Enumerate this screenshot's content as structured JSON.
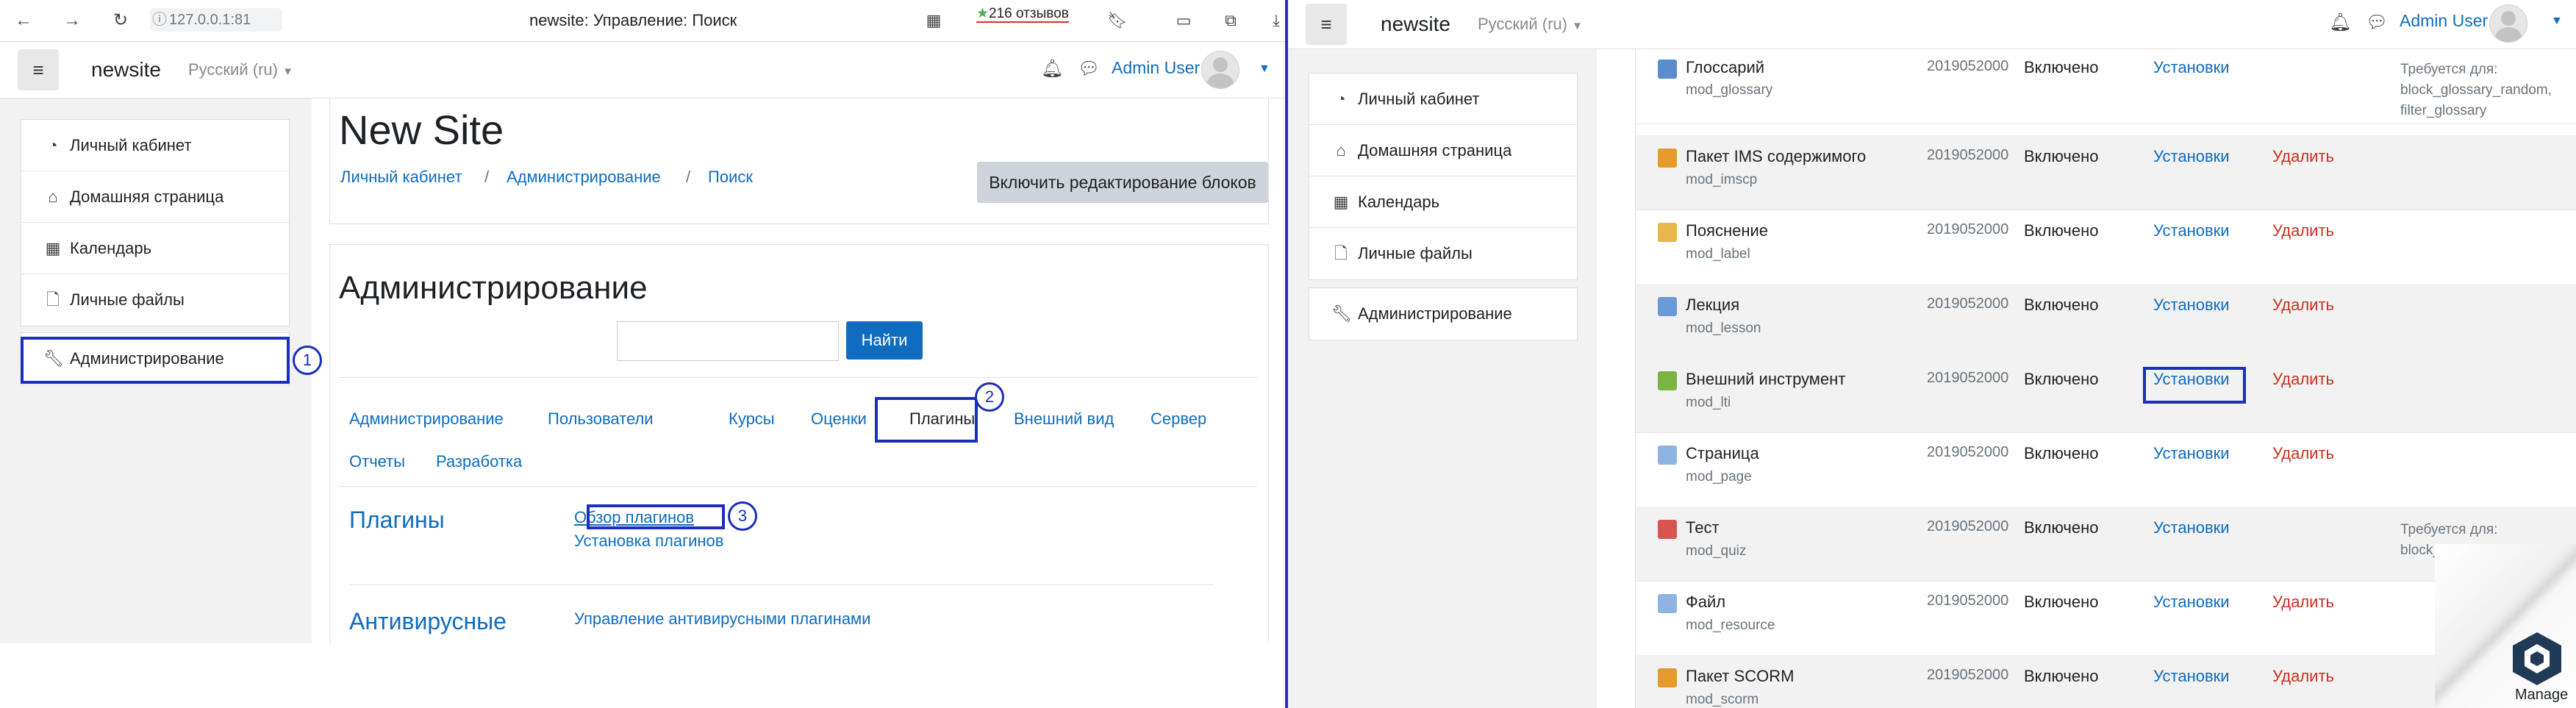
{
  "left": {
    "browser": {
      "url": "127.0.0.1:81",
      "tab_title": "newsite: Управление: Поиск",
      "reviews": "216 отзывов"
    },
    "navbar": {
      "brand": "newsite",
      "language": "Русский (ru)",
      "user": "Admin User"
    },
    "drawer": {
      "items": [
        "Личный кабинет",
        "Домашняя страница",
        "Календарь",
        "Личные файлы"
      ],
      "admin": "Администрирование"
    },
    "header": {
      "site_title": "New Site",
      "breadcrumb": [
        "Личный кабинет",
        "Администрирование",
        "Поиск"
      ],
      "edit_button": "Включить редактирование блоков"
    },
    "admin": {
      "title": "Администрирование",
      "search_value": "",
      "search_button": "Найти",
      "tabs": [
        "Администрирование",
        "Пользователи",
        "Курсы",
        "Оценки",
        "Плагины",
        "Внешний вид",
        "Сервер",
        "Отчеты",
        "Разработка"
      ],
      "sections": [
        {
          "title": "Плагины",
          "links": [
            "Обзор плагинов",
            "Установка плагинов"
          ]
        },
        {
          "title": "Антивирусные",
          "links": [
            "Управление антивирусными плагинами"
          ]
        }
      ]
    },
    "step_markers": [
      "1",
      "2",
      "3"
    ]
  },
  "right": {
    "navbar": {
      "brand": "newsite",
      "language": "Русский (ru)",
      "user": "Admin User"
    },
    "drawer": {
      "items": [
        "Личный кабинет",
        "Домашняя страница",
        "Календарь",
        "Личные файлы"
      ],
      "admin": "Администрирование"
    },
    "plugins": [
      {
        "name": "Глоссарий",
        "module": "mod_glossary",
        "version": "2019052000",
        "status": "Включено",
        "settings": "Установки",
        "delete": "",
        "requires": [
          "Требуется для:",
          "block_glossary_random,",
          "filter_glossary"
        ],
        "icon_color": "#5b8bd0"
      },
      {
        "name": "Пакет IMS содержимого",
        "module": "mod_imscp",
        "version": "2019052000",
        "status": "Включено",
        "settings": "Установки",
        "delete": "Удалить",
        "requires": [],
        "icon_color": "#e59a2b"
      },
      {
        "name": "Пояснение",
        "module": "mod_label",
        "version": "2019052000",
        "status": "Включено",
        "settings": "Установки",
        "delete": "Удалить",
        "requires": [],
        "icon_color": "#e8b64a"
      },
      {
        "name": "Лекция",
        "module": "mod_lesson",
        "version": "2019052000",
        "status": "Включено",
        "settings": "Установки",
        "delete": "Удалить",
        "requires": [],
        "icon_color": "#6a9ad8"
      },
      {
        "name": "Внешний инструмент",
        "module": "mod_lti",
        "version": "2019052000",
        "status": "Включено",
        "settings": "Установки",
        "delete": "Удалить",
        "requires": [],
        "icon_color": "#7cb342"
      },
      {
        "name": "Страница",
        "module": "mod_page",
        "version": "2019052000",
        "status": "Включено",
        "settings": "Установки",
        "delete": "Удалить",
        "requires": [],
        "icon_color": "#8fb4e3"
      },
      {
        "name": "Тест",
        "module": "mod_quiz",
        "version": "2019052000",
        "status": "Включено",
        "settings": "Установки",
        "delete": "",
        "requires": [
          "Требуется для:",
          "block_quiz_results"
        ],
        "icon_color": "#d9534f"
      },
      {
        "name": "Файл",
        "module": "mod_resource",
        "version": "2019052000",
        "status": "Включено",
        "settings": "Установки",
        "delete": "Удалить",
        "requires": [],
        "icon_color": "#8fb4e3"
      },
      {
        "name": "Пакет SCORM",
        "module": "mod_scorm",
        "version": "2019052000",
        "status": "Включено",
        "settings": "Установки",
        "delete": "Удалить",
        "requires": [],
        "icon_color": "#e59a2b"
      }
    ],
    "manage_label": "Manage"
  },
  "colors": {
    "link": "#0f6cbf",
    "delete": "#ca3120",
    "highlight": "#1b2ebc",
    "button_primary": "#0f6cbf"
  }
}
